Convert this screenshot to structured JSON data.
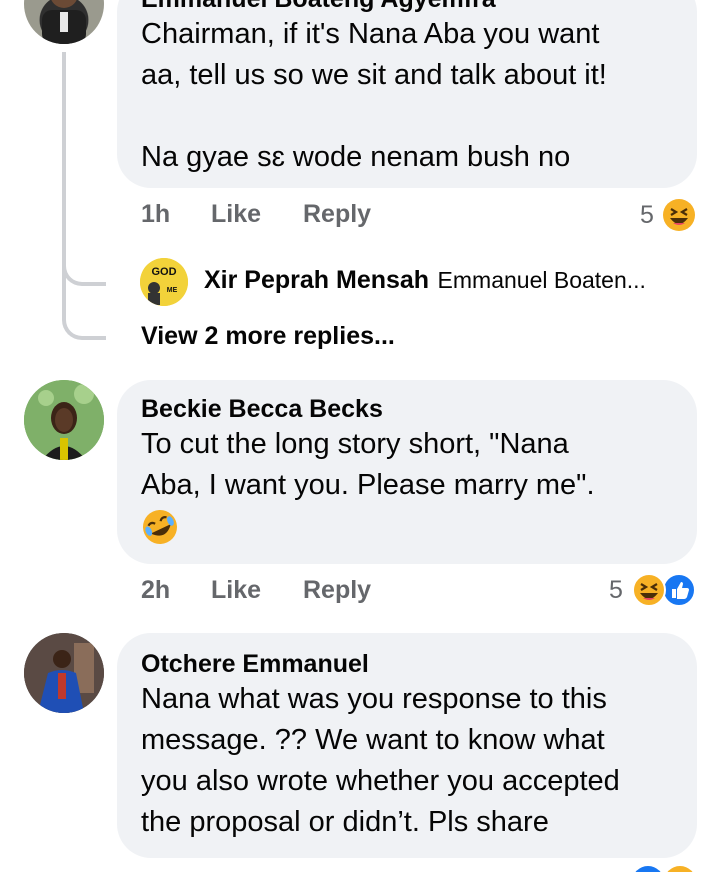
{
  "comments": [
    {
      "author": "Emmanuel Boateng Agyemfra",
      "lines": [
        "Chairman, if it's Nana Aba you want",
        "aa, tell us so we sit and talk about it!",
        "",
        "Na gyae sɛ wode nenam bush no"
      ],
      "time": "1h",
      "like": "Like",
      "reply": "Reply",
      "reactions": "5"
    },
    {
      "reply_author": "Xir Peprah Mensah",
      "reply_text": "Emmanuel Boaten...",
      "view_more": "View 2 more replies..."
    },
    {
      "author": "Beckie Becca Becks",
      "lines": [
        "To cut the long story short,  \"Nana",
        "Aba, I want you.  Please marry me\"."
      ],
      "time": "2h",
      "like": "Like",
      "reply": "Reply",
      "reactions": "5"
    },
    {
      "author": "Otchere Emmanuel",
      "lines": [
        "Nana what was you response to this",
        "message. ?? We want to know what",
        "you also wrote whether you accepted",
        "the proposal or didn’t. Pls share"
      ]
    }
  ],
  "colors": {
    "bubble": "#f0f2f5",
    "meta": "#65676b",
    "like_blue": "#1877f2",
    "haha_yellow": "#f7b125"
  }
}
